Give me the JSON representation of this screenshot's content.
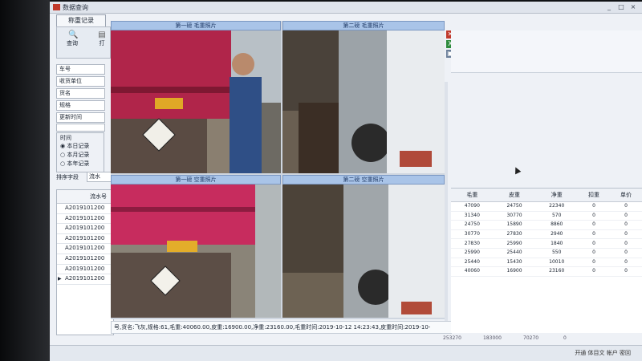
{
  "window": {
    "title": "数据查询",
    "minimize": "_",
    "maximize": "□",
    "close": "×"
  },
  "left": {
    "tab": "称重记录",
    "toolbar": {
      "query_label": "查询",
      "print_label": "打"
    },
    "fields": [
      "车号",
      "收货单位",
      "货名",
      "规格",
      "更新时间"
    ],
    "time_group": {
      "title": "时间",
      "options": [
        "本日记录",
        "本月记录",
        "本年记录"
      ],
      "selected": "本日记录"
    },
    "sort": {
      "label": "排序字段",
      "value": "流水"
    },
    "serial_header": "流水号",
    "serial_rows": [
      "A2019101200",
      "A2019101200",
      "A2019101200",
      "A2019101200",
      "A2019101200",
      "A2019101200",
      "A2019101200",
      "A2019101200"
    ]
  },
  "photos": {
    "captions": [
      "第一磅 毛重照片",
      "第二磅 毛重照片",
      "第一磅 空重照片",
      "第二磅 空重照片"
    ]
  },
  "status_line": "号,货名:飞灰,规格:61,毛重:40060.00,皮重:16900.00,净重:23160.00,毛重时间:2019-10-12 14:23:43,皮重时间:2019-10-",
  "grid": {
    "headers": [
      "毛重",
      "皮重",
      "净重",
      "扣重",
      "单价"
    ],
    "rows": [
      [
        "47090",
        "24750",
        "22340",
        "0",
        "0"
      ],
      [
        "31340",
        "30770",
        "570",
        "0",
        "0"
      ],
      [
        "24750",
        "15890",
        "8860",
        "0",
        "0"
      ],
      [
        "30770",
        "27830",
        "2940",
        "0",
        "0"
      ],
      [
        "27830",
        "25990",
        "1840",
        "0",
        "0"
      ],
      [
        "25990",
        "25440",
        "550",
        "0",
        "0"
      ],
      [
        "25440",
        "15430",
        "10010",
        "0",
        "0"
      ],
      [
        "40060",
        "16900",
        "23160",
        "0",
        "0"
      ]
    ],
    "totals": [
      "253270",
      "183000",
      "70270",
      "0"
    ]
  },
  "bottom_status": "开通 体目文 帐户 密回"
}
